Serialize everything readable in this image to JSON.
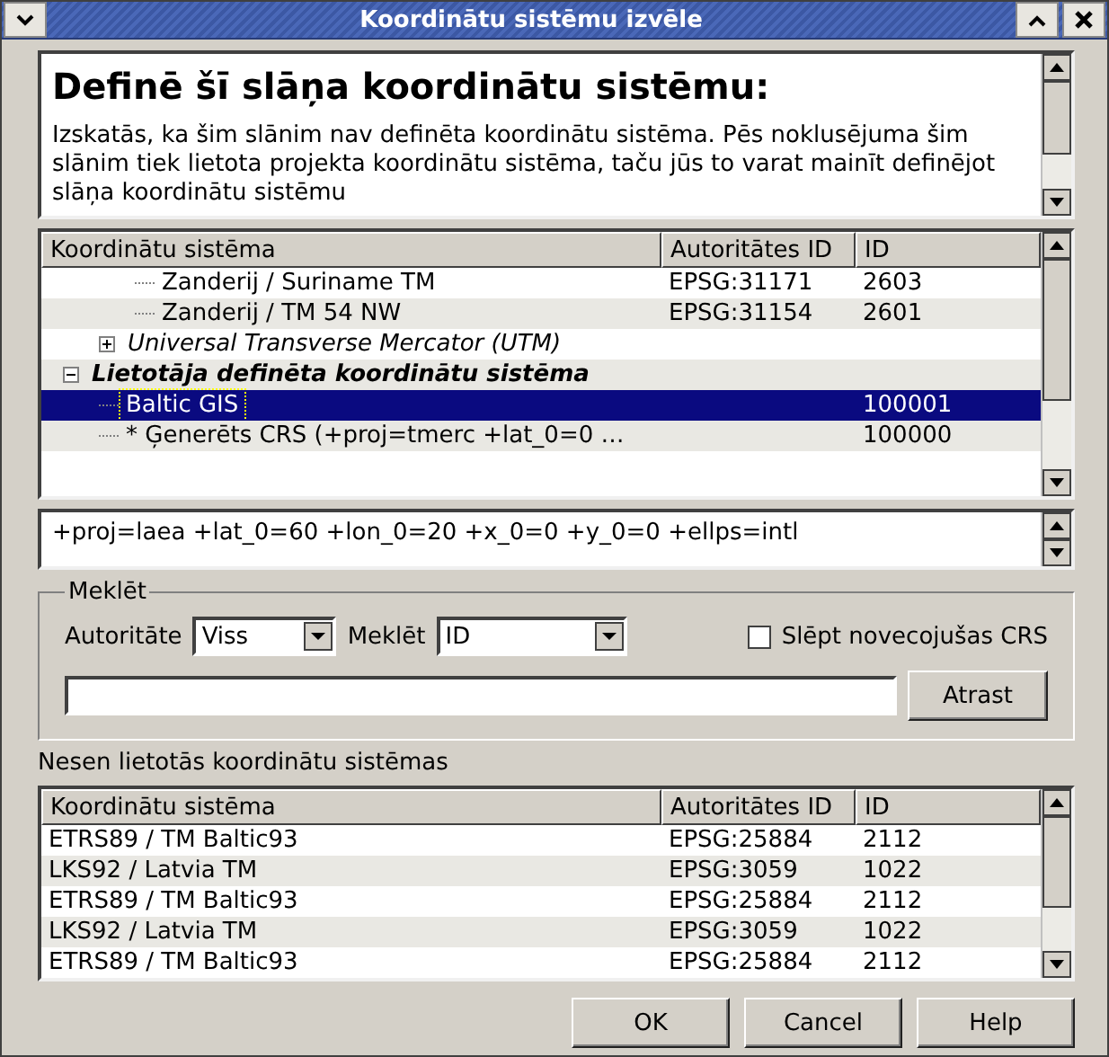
{
  "window": {
    "title": "Koordinātu sistēmu izvēle"
  },
  "description": {
    "heading": "Definē šī slāņa koordinātu sistēmu:",
    "text": "Izskatās, ka šim slānim nav definēta koordinātu sistēma. Pēs noklusējuma šim slānim tiek lietota projekta koordinātu sistēma, taču jūs to varat mainīt definējot slāņa koordinātu sistēmu"
  },
  "crs_tree": {
    "columns": [
      "Koordinātu sistēma",
      "Autoritātes ID",
      "ID"
    ],
    "nodes": [
      {
        "children": [
          {
            "children": [
              {
                "label": "Zanderij / Suriname TM",
                "authority_id": "EPSG:31171",
                "id": "2603",
                "selected": false
              },
              {
                "label": "Zanderij / TM 54 NW",
                "authority_id": "EPSG:31154",
                "id": "2601",
                "selected": false
              }
            ]
          },
          {
            "label": "Universal Transverse Mercator (UTM)",
            "kind": "category",
            "expanded": false,
            "selected": false
          }
        ]
      },
      {
        "label": "Lietotāja definēta koordinātu sistēma",
        "kind": "user",
        "expanded": true,
        "selected": false,
        "children": [
          {
            "label": "Baltic GIS",
            "id": "100001",
            "selected": true
          },
          {
            "label": "* Ģenerēts CRS (+proj=tmerc +lat_0=0 …",
            "id": "100000",
            "selected": false
          }
        ]
      }
    ]
  },
  "proj_string": "+proj=laea +lat_0=60 +lon_0=20 +x_0=0 +y_0=0 +ellps=intl",
  "search": {
    "title": "Meklēt",
    "authority_label": "Autoritāte",
    "authority_value": "Viss",
    "field_label": "Meklēt",
    "field_value": "ID",
    "hide_deprecated": {
      "label": "Slēpt novecojušas CRS",
      "checked": false
    },
    "find_button": "Atrast"
  },
  "recent": {
    "title": "Nesen lietotās koordinātu sistēmas",
    "columns": [
      "Koordinātu sistēma",
      "Autoritātes ID",
      "ID"
    ],
    "rows": [
      {
        "cells": [
          "ETRS89 / TM Baltic93",
          "EPSG:25884",
          "2112"
        ],
        "selected": false
      },
      {
        "cells": [
          "LKS92 / Latvia TM",
          "EPSG:3059",
          "1022"
        ],
        "selected": false
      },
      {
        "cells": [
          "ETRS89 / TM Baltic93",
          "EPSG:25884",
          "2112"
        ],
        "selected": false
      },
      {
        "cells": [
          "LKS92 / Latvia TM",
          "EPSG:3059",
          "1022"
        ],
        "selected": false
      },
      {
        "cells": [
          "ETRS89 / TM Baltic93",
          "EPSG:25884",
          "2112"
        ],
        "selected": false
      }
    ]
  },
  "buttons": [
    "OK",
    "Cancel",
    "Help"
  ]
}
